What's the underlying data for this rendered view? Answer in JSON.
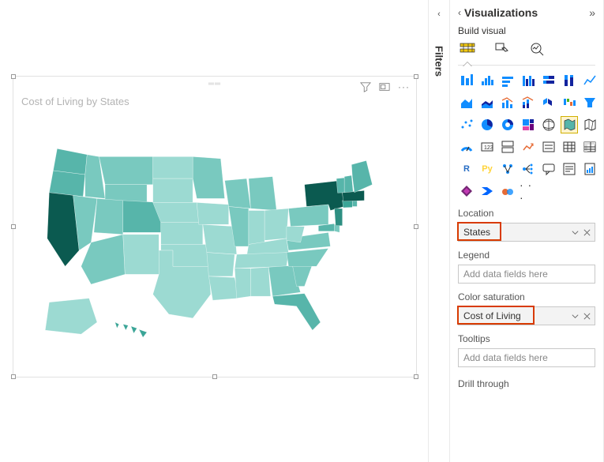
{
  "panel": {
    "title": "Visualizations",
    "subtitle": "Build visual"
  },
  "filters": {
    "label": "Filters"
  },
  "visual": {
    "title": "Cost of Living by States"
  },
  "wells": {
    "location": {
      "label": "Location",
      "value": "States"
    },
    "legend": {
      "label": "Legend",
      "placeholder": "Add data fields here"
    },
    "color_saturation": {
      "label": "Color saturation",
      "value": "Cost of Living"
    },
    "tooltips": {
      "label": "Tooltips",
      "placeholder": "Add data fields here"
    },
    "drill": {
      "label": "Drill through"
    }
  },
  "viz_gallery": {
    "more": "· · ·",
    "r_label": "R",
    "py_label": "Py"
  },
  "colors": {
    "c1": "#57B5AA",
    "c2": "#79C9BF",
    "c3": "#9CDAD2",
    "c4": "#BFE8E3",
    "c5": "#3BA597",
    "c6": "#2E8F82",
    "c7": "#0B5A50",
    "c8": "#1B7768"
  },
  "chart_data": {
    "type": "heatmap",
    "title": "Cost of Living by States",
    "color_field": "Cost of Living",
    "location_field": "States",
    "series": [
      {
        "state": "CA",
        "bucket": 8
      },
      {
        "state": "NY",
        "bucket": 8
      },
      {
        "state": "MA",
        "bucket": 8
      },
      {
        "state": "NJ",
        "bucket": 7
      },
      {
        "state": "HI",
        "bucket": 6
      },
      {
        "state": "CT",
        "bucket": 6
      },
      {
        "state": "CO",
        "bucket": 5
      },
      {
        "state": "OR",
        "bucket": 5
      },
      {
        "state": "WA",
        "bucket": 5
      },
      {
        "state": "FL",
        "bucket": 5
      },
      {
        "state": "ME",
        "bucket": 5
      },
      {
        "state": "NH",
        "bucket": 5
      },
      {
        "state": "VT",
        "bucket": 5
      },
      {
        "state": "RI",
        "bucket": 5
      },
      {
        "state": "MD",
        "bucket": 5
      },
      {
        "state": "NV",
        "bucket": 3
      },
      {
        "state": "UT",
        "bucket": 3
      },
      {
        "state": "AZ",
        "bucket": 3
      },
      {
        "state": "MT",
        "bucket": 3
      },
      {
        "state": "ID",
        "bucket": 3
      },
      {
        "state": "WY",
        "bucket": 3
      },
      {
        "state": "MN",
        "bucket": 3
      },
      {
        "state": "WI",
        "bucket": 3
      },
      {
        "state": "MI",
        "bucket": 3
      },
      {
        "state": "IL",
        "bucket": 3
      },
      {
        "state": "PA",
        "bucket": 3
      },
      {
        "state": "VA",
        "bucket": 3
      },
      {
        "state": "NC",
        "bucket": 3
      },
      {
        "state": "SC",
        "bucket": 3
      },
      {
        "state": "GA",
        "bucket": 3
      },
      {
        "state": "DE",
        "bucket": 3
      },
      {
        "state": "TX",
        "bucket": 2
      },
      {
        "state": "NM",
        "bucket": 2
      },
      {
        "state": "ND",
        "bucket": 2
      },
      {
        "state": "SD",
        "bucket": 2
      },
      {
        "state": "NE",
        "bucket": 2
      },
      {
        "state": "KS",
        "bucket": 2
      },
      {
        "state": "OK",
        "bucket": 2
      },
      {
        "state": "IA",
        "bucket": 2
      },
      {
        "state": "MO",
        "bucket": 2
      },
      {
        "state": "AR",
        "bucket": 2
      },
      {
        "state": "LA",
        "bucket": 2
      },
      {
        "state": "MS",
        "bucket": 2
      },
      {
        "state": "AL",
        "bucket": 2
      },
      {
        "state": "TN",
        "bucket": 2
      },
      {
        "state": "KY",
        "bucket": 2
      },
      {
        "state": "IN",
        "bucket": 2
      },
      {
        "state": "OH",
        "bucket": 2
      },
      {
        "state": "WV",
        "bucket": 2
      },
      {
        "state": "AK",
        "bucket": 2
      }
    ]
  }
}
